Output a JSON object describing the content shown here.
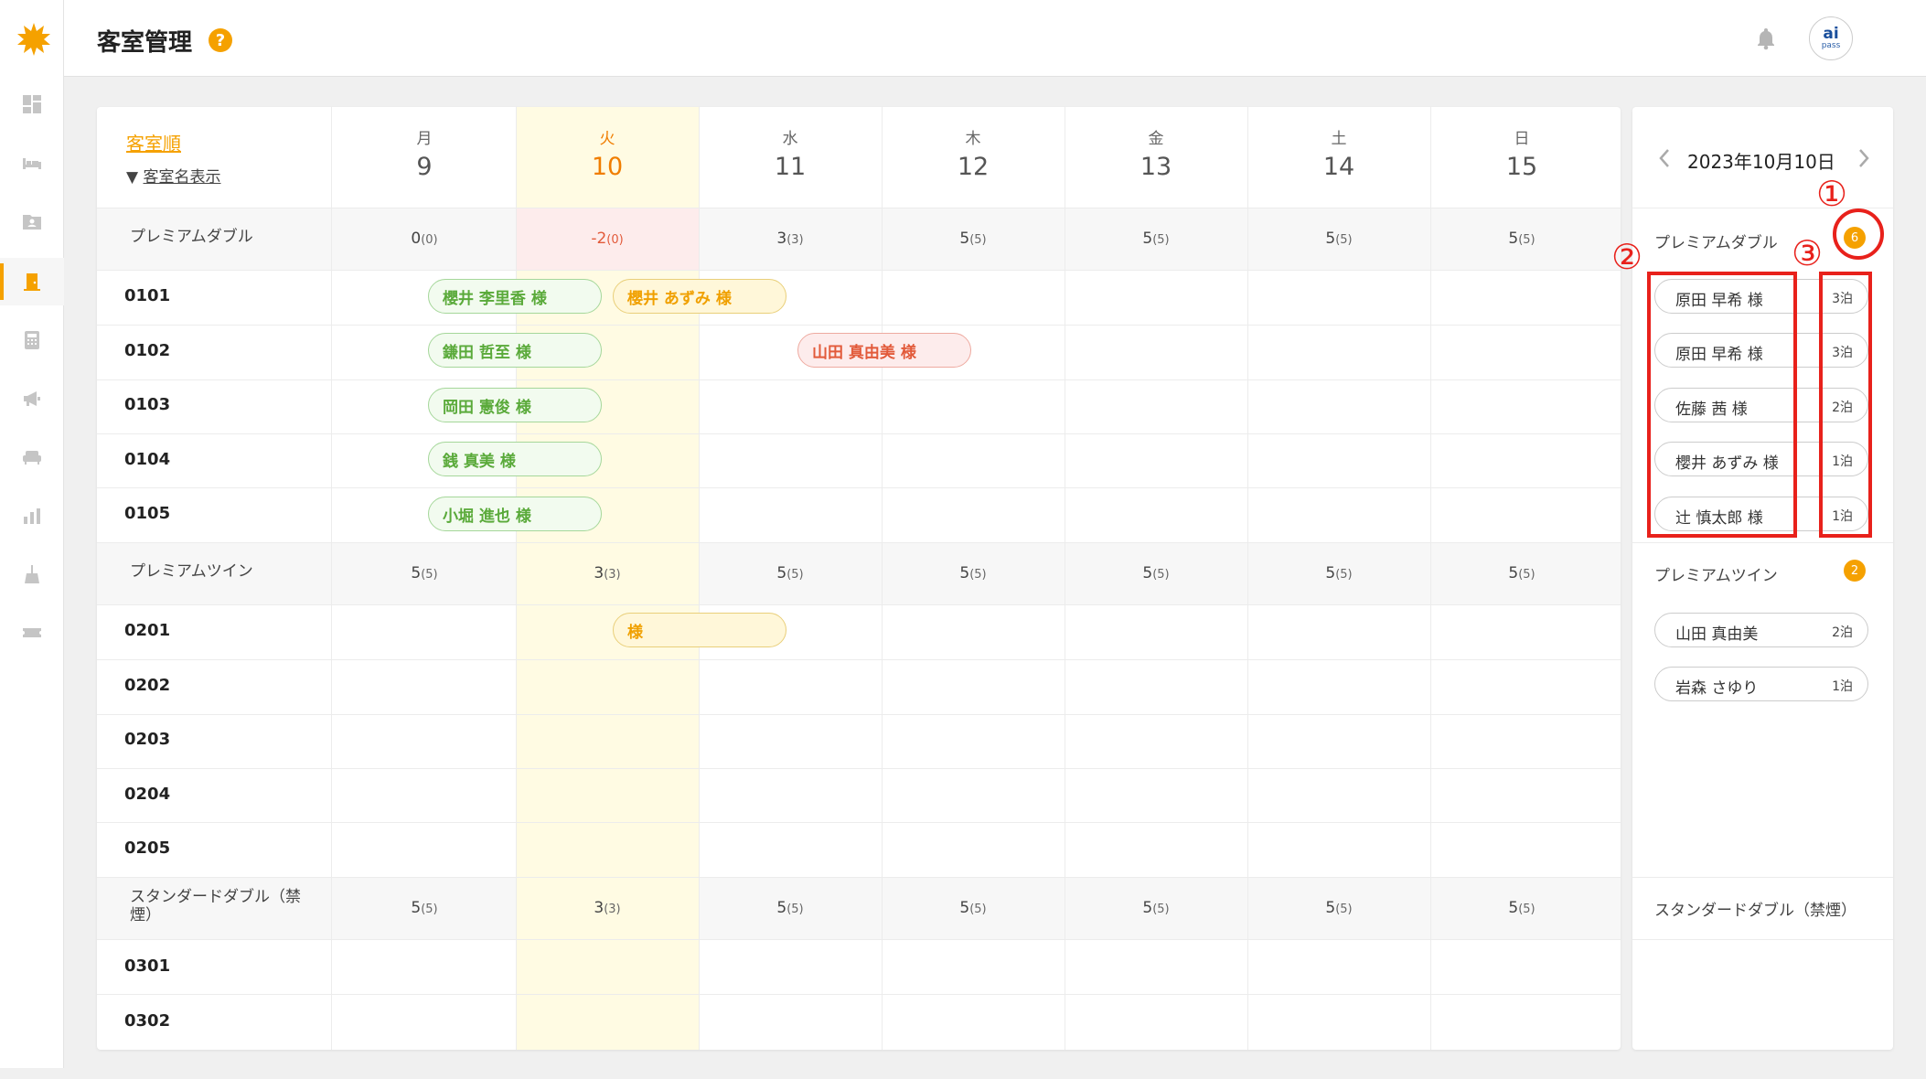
{
  "header": {
    "title": "客室管理",
    "help": "?"
  },
  "user": {
    "avatar_main": "ai",
    "avatar_sub": "pass"
  },
  "calendar": {
    "sort_label": "客室順",
    "name_toggle": "客室名表示",
    "days": [
      {
        "dow": "月",
        "date": "9"
      },
      {
        "dow": "火",
        "date": "10"
      },
      {
        "dow": "水",
        "date": "11"
      },
      {
        "dow": "木",
        "date": "12"
      },
      {
        "dow": "金",
        "date": "13"
      },
      {
        "dow": "土",
        "date": "14"
      },
      {
        "dow": "日",
        "date": "15"
      }
    ],
    "sections": [
      {
        "name": "プレミアムダブル",
        "counts": [
          [
            "0",
            "(0)"
          ],
          [
            "-2",
            "(0)"
          ],
          [
            "3",
            "(3)"
          ],
          [
            "5",
            "(5)"
          ],
          [
            "5",
            "(5)"
          ],
          [
            "5",
            "(5)"
          ],
          [
            "5",
            "(5)"
          ]
        ],
        "rooms": [
          "0101",
          "0102",
          "0103",
          "0104",
          "0105"
        ]
      },
      {
        "name": "プレミアムツイン",
        "counts": [
          [
            "5",
            "(5)"
          ],
          [
            "3",
            "(3)"
          ],
          [
            "5",
            "(5)"
          ],
          [
            "5",
            "(5)"
          ],
          [
            "5",
            "(5)"
          ],
          [
            "5",
            "(5)"
          ],
          [
            "5",
            "(5)"
          ]
        ],
        "rooms": [
          "0201",
          "0202",
          "0203",
          "0204",
          "0205"
        ]
      },
      {
        "name": "スタンダードダブル（禁煙）",
        "counts": [
          [
            "5",
            "(5)"
          ],
          [
            "3",
            "(3)"
          ],
          [
            "5",
            "(5)"
          ],
          [
            "5",
            "(5)"
          ],
          [
            "5",
            "(5)"
          ],
          [
            "5",
            "(5)"
          ],
          [
            "5",
            "(5)"
          ]
        ],
        "rooms": [
          "0301",
          "0302"
        ]
      }
    ],
    "bookings": [
      {
        "label": "櫻井 李里香  様",
        "status": "green"
      },
      {
        "label": "櫻井 あずみ  様",
        "status": "yellow"
      },
      {
        "label": "鎌田 哲至  様",
        "status": "green"
      },
      {
        "label": "山田 真由美  様",
        "status": "red"
      },
      {
        "label": "岡田 憲俊  様",
        "status": "green"
      },
      {
        "label": "銭 真美  様",
        "status": "green"
      },
      {
        "label": "小堀 進也  様",
        "status": "green"
      },
      {
        "label": "様",
        "status": "yellow"
      }
    ]
  },
  "panel": {
    "date": "2023年10月10日",
    "sections": [
      {
        "name": "プレミアムダブル",
        "count": "6",
        "guests": [
          {
            "name": "原田 早希  様",
            "stay": "3泊"
          },
          {
            "name": "原田 早希  様",
            "stay": "3泊"
          },
          {
            "name": "佐藤 茜  様",
            "stay": "2泊"
          },
          {
            "name": "櫻井 あずみ  様",
            "stay": "1泊"
          },
          {
            "name": "辻 慎太郎  様",
            "stay": "1泊"
          }
        ]
      },
      {
        "name": "プレミアムツイン",
        "count": "2",
        "guests": [
          {
            "name": "山田 真由美",
            "stay": "2泊"
          },
          {
            "name": "岩森 さゆり",
            "stay": "1泊"
          }
        ]
      },
      {
        "name": "スタンダードダブル（禁煙）"
      }
    ]
  },
  "annotations": [
    "①",
    "②",
    "③"
  ],
  "colors": {
    "accent": "#f5a100",
    "today_bg": "#fffbe3",
    "checkin": "#5aaa3a",
    "stay": "#f0a000",
    "warning": "#e25a3a",
    "annotation": "#e8211b"
  },
  "icons": [
    "sun-logo-icon",
    "dashboard-icon",
    "bed-icon",
    "contact-folder-icon",
    "door-icon",
    "calculator-icon",
    "megaphone-icon",
    "sofa-icon",
    "bar-chart-icon",
    "broom-icon",
    "ticket-icon",
    "bell-icon",
    "chevron-down-icon",
    "chevron-left-icon",
    "chevron-right-icon"
  ]
}
